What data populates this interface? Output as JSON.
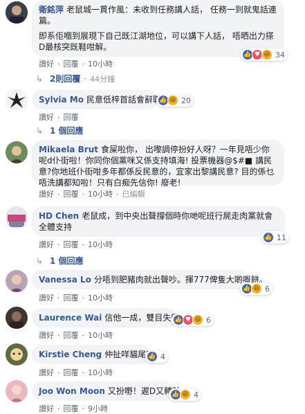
{
  "actions": {
    "like": "讚好",
    "reply": "回覆",
    "sep": "·"
  },
  "comments": [
    {
      "name": "衛銘萍",
      "text": "老鼠城一貫作風：未收到任務講人話， 任務一到就鬼話連篇。",
      "text2": "即系佢嗰到展現下自己既江湖地位，可以講下人話， 唔晒出力搽D最核突既鞋咁解。",
      "time": "10小時",
      "reactions": "34",
      "replies_label": "2則回覆",
      "replies_time": "44分鐘"
    },
    {
      "name": "Sylvia Mo",
      "text": "民意低梓首話會辭職",
      "reactions": "20",
      "replies_label": "1 個回應"
    },
    {
      "name": "Mikaela Brut",
      "text": "食屎啦你， 出嚟調停扮好人呀？一年見唔少你呢d仆街啦！你同你個黨咪又係支持填海! 投票機器@$#■ 講民意?你地班仆街咁多年都係反民意的，宜家出黎講民意? 目的係乜唔洗講都知啦！只有白痴先信你! 廢老!",
      "time": "10小時",
      "edited": "已編輯"
    },
    {
      "name": "HD Chen",
      "text": "老鼠成，到中央出聲撐個時你哋呢班行屍走肉黨就會全體支持",
      "time": "10小時",
      "reactions": "11",
      "replies_label": "1 個回應"
    },
    {
      "name": "Vanessa Lo",
      "text": "分唔到肥豬肉就出聲吵。揮777俾隻大啲嘅餅。",
      "time": "10小時",
      "reactions": "6"
    },
    {
      "name": "Laurence Wai",
      "text": "信他一成，雙目失明",
      "time": "10小時",
      "reactions": "6"
    },
    {
      "name": "Kirstie Cheng",
      "text": "仲扯咩貓尾吖",
      "time": "10小時",
      "reactions": "4"
    },
    {
      "name": "Joo Won Moon",
      "text": "又扮嘢！遲D又轉軚",
      "time": "9小時",
      "reactions": "4"
    }
  ]
}
